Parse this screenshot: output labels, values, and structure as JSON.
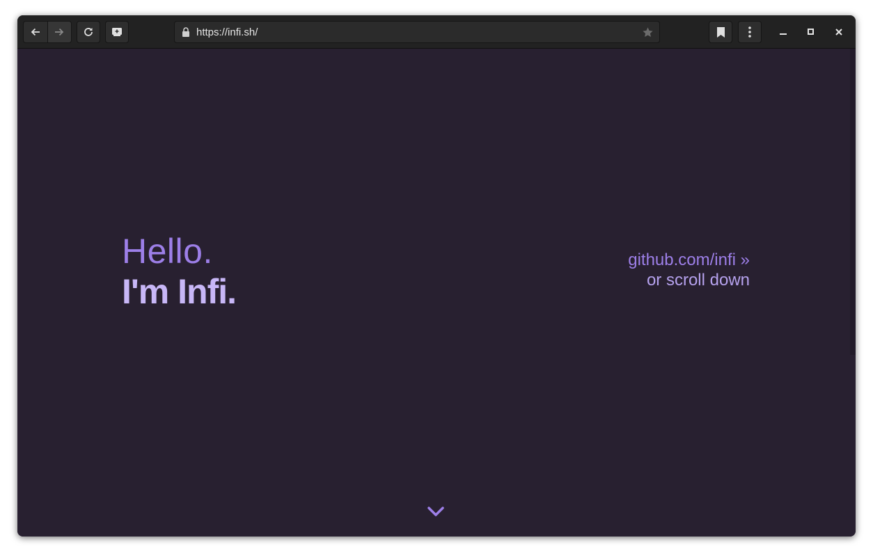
{
  "browser": {
    "url": "https://infi.sh/",
    "icons": {
      "back": "arrow-left-icon",
      "forward": "arrow-right-icon",
      "reload": "reload-icon",
      "new_tab": "add-tab-icon",
      "lock": "lock-icon",
      "star": "star-icon",
      "bookmarks": "bookmark-icon",
      "menu": "kebab-menu-icon",
      "minimize": "minimize-icon",
      "maximize": "maximize-icon",
      "close": "close-icon"
    }
  },
  "page": {
    "greeting": "Hello.",
    "intro": "I'm Infi.",
    "github_link": "github.com/infi »",
    "scroll_hint": "or scroll down",
    "scroll_icon": "chevron-down-icon"
  },
  "colors": {
    "background": "#282030",
    "accent": "#9d7fe8",
    "accent_light": "#c8b7f7",
    "toolbar": "#222222"
  }
}
